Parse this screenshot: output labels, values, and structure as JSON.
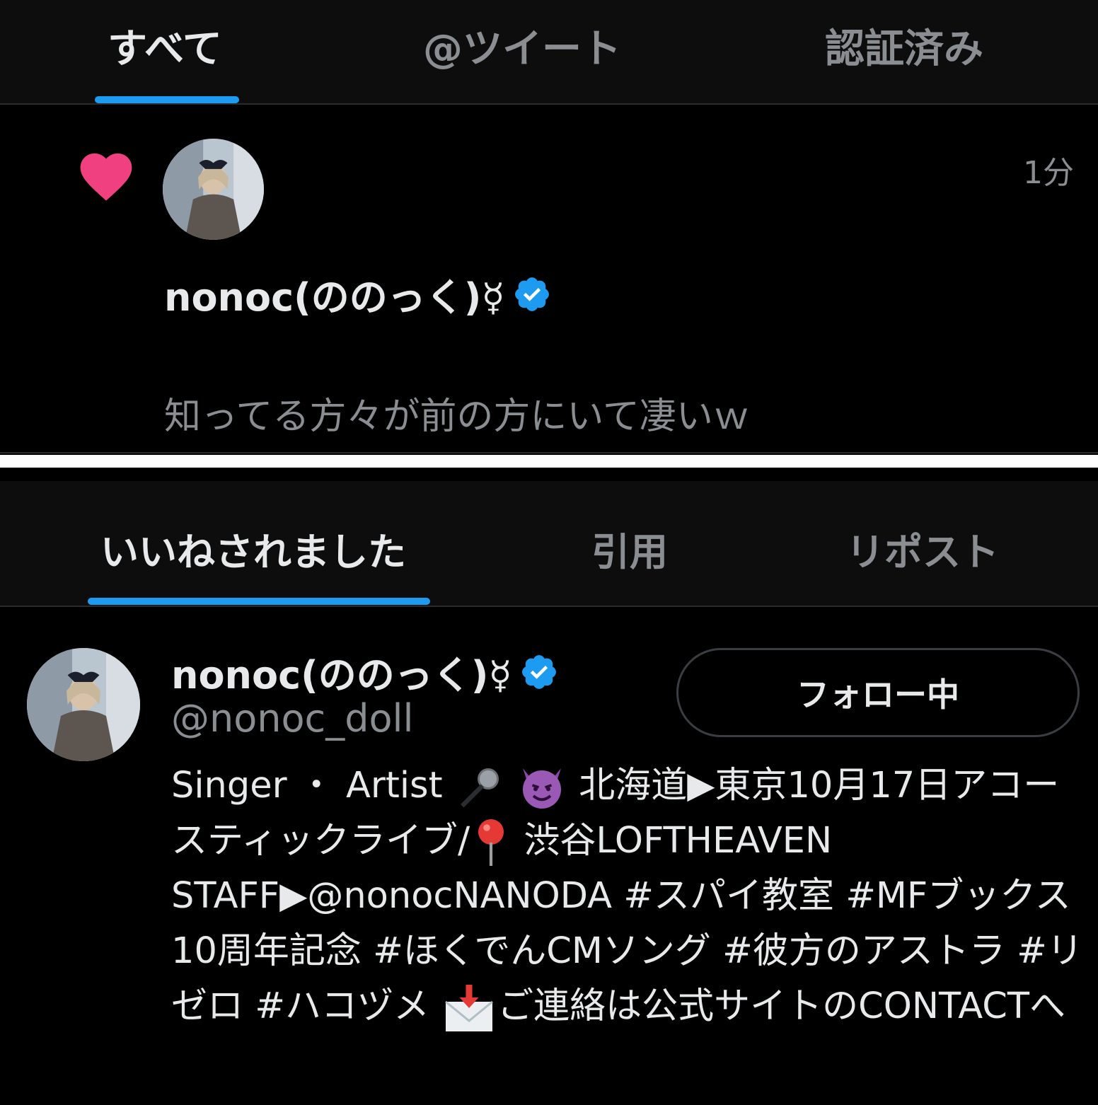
{
  "top_tabs": [
    {
      "label": "すべて",
      "active": true
    },
    {
      "label": "@ツイート",
      "active": false
    },
    {
      "label": "認証済み",
      "active": false
    }
  ],
  "notification": {
    "icon": "heart-icon",
    "time": "1分",
    "user_name": "nonoc(ののっく)☿",
    "text": "知ってる方々が前の方にいて凄いｗ"
  },
  "bottom_tabs": [
    {
      "label": "いいねされました",
      "active": true
    },
    {
      "label": "引用",
      "active": false
    },
    {
      "label": "リポスト",
      "active": false
    }
  ],
  "profile": {
    "name": "nonoc(ののっく)☿",
    "handle": "@nonoc_doll",
    "follow_label": "フォロー中",
    "bio": {
      "part1": "Singer ・ Artist ",
      "part2": " ",
      "part3": " 北海道▶東京10月17日アコースティックライブ/",
      "part4": " 渋谷LOFTHEAVEN STAFF▶@nonocNANODA #スパイ教室 #MFブックス10周年記念 #ほくでんCMソング #彼方のアストラ #リゼロ #ハコヅメ ",
      "part5": "ご連絡は公式サイトのCONTACTへ"
    }
  },
  "colors": {
    "accent": "#1d9bf0",
    "heart": "#f91880",
    "muted_text": "#8a8d91",
    "background": "#000000"
  }
}
